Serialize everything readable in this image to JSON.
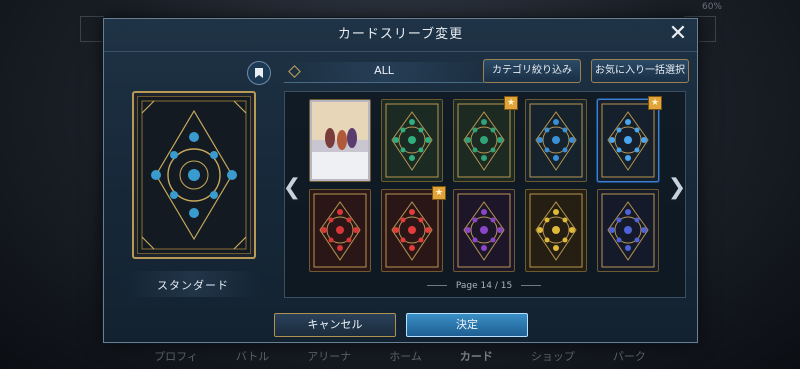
{
  "status": {
    "battery": "60%"
  },
  "bg_tabs": [
    "プロフィ",
    "バトル",
    "アリーナ",
    "ホーム",
    "カード",
    "ショップ",
    "パーク"
  ],
  "bg_tabs_active_index": 4,
  "modal": {
    "title": "カードスリーブ変更",
    "close_glyph": "✕",
    "category": "ALL",
    "filter_button": "カテゴリ絞り込み",
    "favorite_bulk_button": "お気に入り一括選択",
    "preview_label": "スタンダード",
    "page_label": "Page",
    "page_current": "14",
    "page_total": "15",
    "page_separator": "/",
    "cancel_button": "キャンセル",
    "confirm_button": "決定",
    "nav_left_glyph": "❮",
    "nav_right_glyph": "❯"
  },
  "sleeves": [
    {
      "name": "sleeve-art-illustration",
      "color": "#b9b6c4",
      "accent": "#e8c99a",
      "favorite": false,
      "selected": false
    },
    {
      "name": "sleeve-green-gold",
      "color": "#1c2a24",
      "accent": "#2fae7e",
      "favorite": false,
      "selected": false
    },
    {
      "name": "sleeve-green-gold-ornate",
      "color": "#1d2a22",
      "accent": "#31a27a",
      "favorite": true,
      "selected": false
    },
    {
      "name": "sleeve-blue-gold",
      "color": "#16222c",
      "accent": "#3a8fd6",
      "favorite": false,
      "selected": false
    },
    {
      "name": "sleeve-blue-gold-selected",
      "color": "#15202c",
      "accent": "#4aa6ee",
      "favorite": true,
      "selected": true
    },
    {
      "name": "sleeve-red-gold",
      "color": "#2a1616",
      "accent": "#d9363a",
      "favorite": false,
      "selected": false
    },
    {
      "name": "sleeve-red-gold-ornate",
      "color": "#2a1617",
      "accent": "#e23c3c",
      "favorite": true,
      "selected": false
    },
    {
      "name": "sleeve-purple-gold",
      "color": "#1d1628",
      "accent": "#8a45c8",
      "favorite": false,
      "selected": false
    },
    {
      "name": "sleeve-gold-yellow",
      "color": "#241f12",
      "accent": "#e1b93a",
      "favorite": false,
      "selected": false
    },
    {
      "name": "sleeve-blue-red-gold",
      "color": "#141a2a",
      "accent": "#4f63d8",
      "favorite": false,
      "selected": false
    }
  ]
}
